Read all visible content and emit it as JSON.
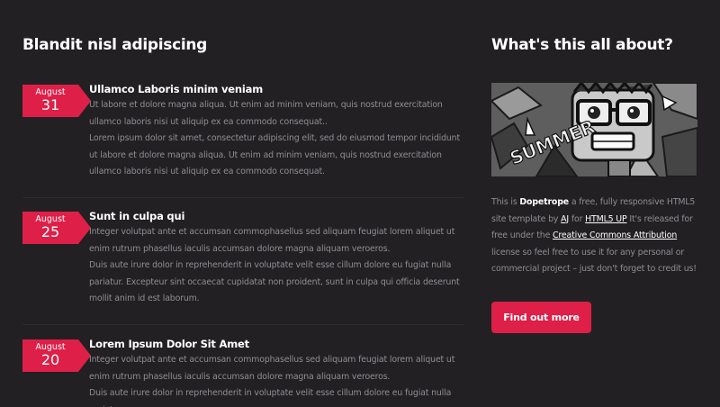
{
  "main": {
    "heading": "Blandit nisl adipiscing",
    "posts": [
      {
        "month": "August",
        "day": "31",
        "title": "Ullamco Laboris minim veniam",
        "paragraphs": [
          "Ut labore et dolore magna aliqua. Ut enim ad minim veniam, quis nostrud exercitation ullamco laboris nisi ut aliquip ex ea commodo consequat..",
          "Lorem ipsum dolor sit amet, consectetur adipiscing elit, sed do eiusmod tempor incididunt ut labore et dolore magna aliqua. Ut enim ad minim veniam, quis nostrud exercitation ullamco laboris nisi ut aliquip ex ea commodo consequat."
        ]
      },
      {
        "month": "August",
        "day": "25",
        "title": "Sunt in culpa qui",
        "paragraphs": [
          "Integer volutpat ante et accumsan commophasellus sed aliquam feugiat lorem aliquet ut enim rutrum phasellus iaculis accumsan dolore magna aliquam veroeros.",
          "Duis aute irure dolor in reprehenderit in voluptate velit esse cillum dolore eu fugiat nulla pariatur. Excepteur sint occaecat cupidatat non proident, sunt in culpa qui officia deserunt mollit anim id est laborum."
        ]
      },
      {
        "month": "August",
        "day": "20",
        "title": "Lorem Ipsum Dolor Sit Amet",
        "paragraphs": [
          "Integer volutpat ante et accumsan commophasellus sed aliquam feugiat lorem aliquet ut enim rutrum phasellus iaculis accumsan dolore magna aliquam veroeros.",
          "Duis aute irure dolor in reprehenderit in voluptate velit esse cillum dolore eu fugiat nulla pariatur."
        ]
      }
    ]
  },
  "sidebar": {
    "heading": "What's this all about?",
    "art_text": "SUMMER",
    "about": {
      "t1": "This is ",
      "brand": "Dopetrope",
      "t2": " a free, fully responsive HTML5 site template by ",
      "author": "AJ",
      "t3": " for ",
      "site": "HTML5 UP",
      "t4": " It's released for free under the ",
      "license": "Creative Commons Attribution",
      "t5": " license so feel free to use it for any personal or commercial project – just don't forget to credit us!"
    },
    "button_label": "Find out more"
  },
  "colors": {
    "background": "#222023",
    "accent": "#de1f48",
    "heading": "#ffffff",
    "body_text": "#8f8d91"
  }
}
